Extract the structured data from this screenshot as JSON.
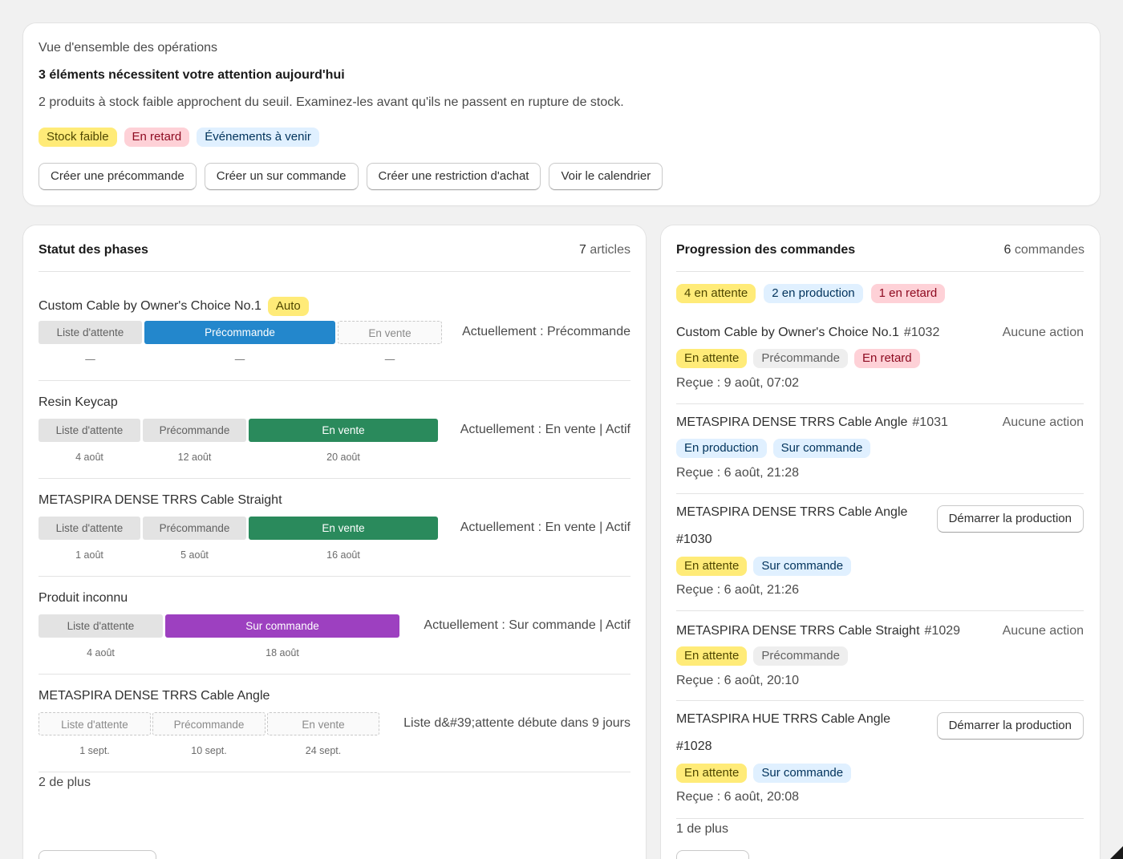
{
  "overview": {
    "kicker": "Vue d'ensemble des opérations",
    "title": "3 éléments nécessitent votre attention aujourd'hui",
    "description": "2 produits à stock faible approchent du seuil. Examinez-les avant qu'ils ne passent en rupture de stock.",
    "tags": [
      "Stock faible",
      "En retard",
      "Événements à venir"
    ],
    "actions": [
      "Créer une précommande",
      "Créer un sur commande",
      "Créer une restriction d'achat",
      "Voir le calendrier"
    ]
  },
  "phases": {
    "title": "Statut des phases",
    "count_number": "7",
    "count_label": "articles",
    "items": [
      {
        "name": "Custom Cable by Owner's Choice No.1",
        "badge": "Auto",
        "status": "Actuellement : Précommande",
        "segments": [
          "Liste d'attente",
          "Précommande",
          "En vente"
        ],
        "dates": [
          "—",
          "—",
          "—"
        ]
      },
      {
        "name": "Resin Keycap",
        "status": "Actuellement : En vente | Actif",
        "segments": [
          "Liste d'attente",
          "Précommande",
          "En vente"
        ],
        "dates": [
          "4 août",
          "12 août",
          "20 août"
        ]
      },
      {
        "name": "METASPIRA DENSE TRRS Cable Straight",
        "status": "Actuellement : En vente | Actif",
        "segments": [
          "Liste d'attente",
          "Précommande",
          "En vente"
        ],
        "dates": [
          "1 août",
          "5 août",
          "16 août"
        ]
      },
      {
        "name": "Produit inconnu",
        "status": "Actuellement : Sur commande | Actif",
        "segments": [
          "Liste d'attente",
          "Sur commande"
        ],
        "dates": [
          "4 août",
          "18 août"
        ]
      },
      {
        "name": "METASPIRA DENSE TRRS Cable Angle",
        "status": "Liste d&#39;attente débute dans 9 jours",
        "segments": [
          "Liste d'attente",
          "Précommande",
          "En vente"
        ],
        "dates": [
          "1 sept.",
          "10 sept.",
          "24 sept."
        ]
      }
    ],
    "more": "2 de plus"
  },
  "orders": {
    "title": "Progression des commandes",
    "count_number": "6",
    "count_label": "commandes",
    "summary_tags": [
      "4 en attente",
      "2 en production",
      "1 en retard"
    ],
    "items": [
      {
        "name": "Custom Cable by Owner's Choice No.1",
        "number": "#1032",
        "action": "Aucune action",
        "tags": [
          "En attente",
          "Précommande",
          "En retard"
        ],
        "received": "Reçue : 9 août, 07:02"
      },
      {
        "name": "METASPIRA DENSE TRRS Cable Angle",
        "number": "#1031",
        "action": "Aucune action",
        "tags": [
          "En production",
          "Sur commande"
        ],
        "received": "Reçue : 6 août, 21:28"
      },
      {
        "name": "METASPIRA DENSE TRRS Cable Angle",
        "number": "#1030",
        "action_button": "Démarrer la production",
        "tags": [
          "En attente",
          "Sur commande"
        ],
        "received": "Reçue : 6 août, 21:26"
      },
      {
        "name": "METASPIRA DENSE TRRS Cable Straight",
        "number": "#1029",
        "action": "Aucune action",
        "tags": [
          "En attente",
          "Précommande"
        ],
        "received": "Reçue : 6 août, 20:10"
      },
      {
        "name": "METASPIRA HUE TRRS Cable Angle",
        "number": "#1028",
        "action_button": "Démarrer la production",
        "tags": [
          "En attente",
          "Sur commande"
        ],
        "received": "Reçue : 6 août, 20:08"
      }
    ],
    "more": "1 de plus"
  }
}
